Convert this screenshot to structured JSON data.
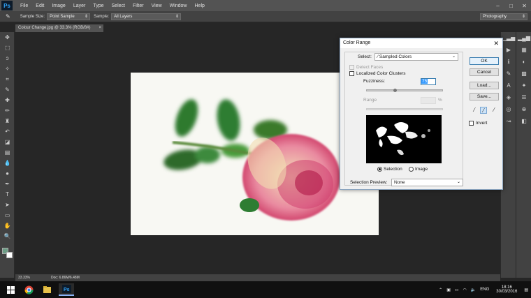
{
  "app": {
    "logo": "Ps",
    "menu": [
      "File",
      "Edit",
      "Image",
      "Layer",
      "Type",
      "Select",
      "Filter",
      "View",
      "Window",
      "Help"
    ],
    "window_controls": [
      "–",
      "□",
      "✕"
    ]
  },
  "options_bar": {
    "sample_size_label": "Sample Size:",
    "sample_size_value": "Point Sample",
    "sample_label": "Sample:",
    "sample_value": "All Layers",
    "workspace": "Photography"
  },
  "document": {
    "tab_title": "Colour Change.jpg @ 33.3% (RGB/8#)",
    "tab_close": "×"
  },
  "status": {
    "zoom": "33.33%",
    "doc_info": "Doc: 6.86M/6.48M"
  },
  "color_range": {
    "title": "Color Range",
    "close": "✕",
    "select_label": "Select:",
    "select_value": "Sampled Colors",
    "detect_faces": "Detect Faces",
    "localized": "Localized Color Clusters",
    "fuzziness_label": "Fuzziness:",
    "fuzziness_value": "75",
    "fuzziness_fraction": 0.375,
    "range_label": "Range",
    "range_unit": "%",
    "selection_label": "Selection",
    "image_label": "Image",
    "selection_preview_label": "Selection Preview:",
    "selection_preview_value": "None",
    "ok": "OK",
    "cancel": "Cancel",
    "load": "Load...",
    "save": "Save...",
    "invert": "Invert"
  },
  "taskbar": {
    "lang": "ENG",
    "time": "18:16",
    "date": "30/03/2016"
  }
}
